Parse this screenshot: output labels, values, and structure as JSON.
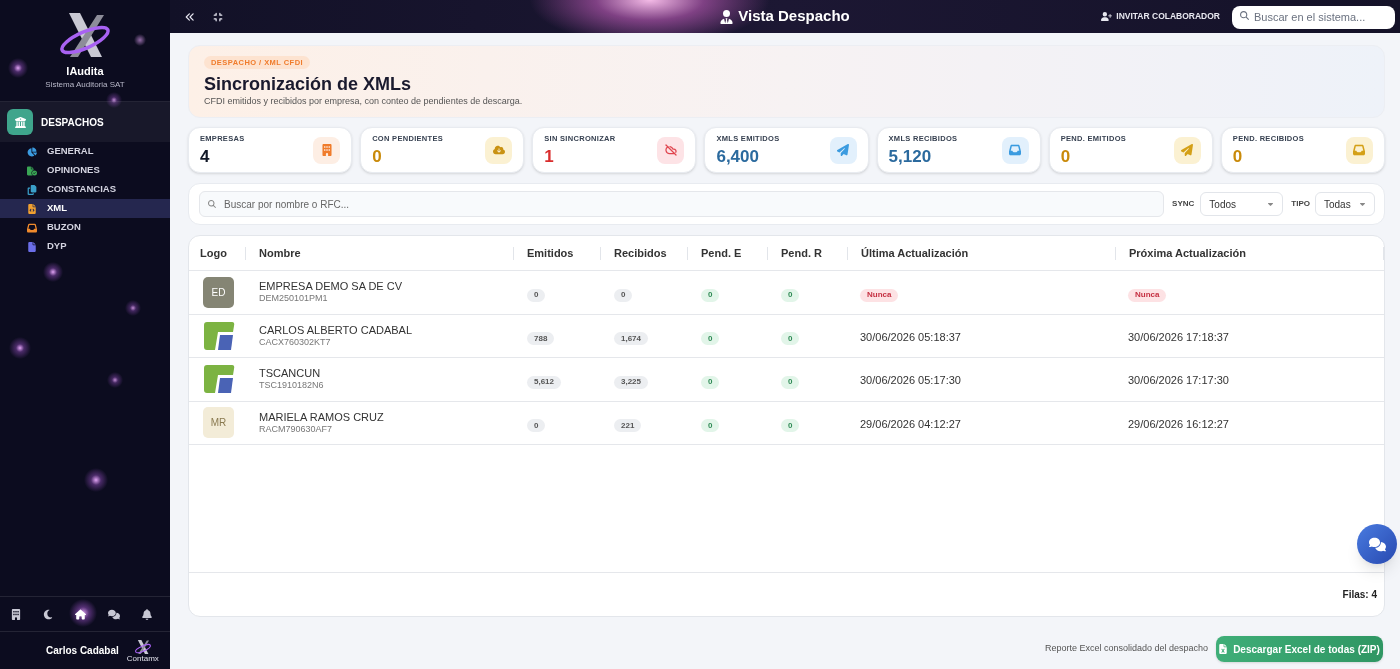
{
  "sidebar": {
    "brand": "IAudita",
    "subtitle": "Sistema Auditoria SAT",
    "section": "DESPACHOS",
    "items": [
      {
        "label": "GENERAL",
        "selected": false
      },
      {
        "label": "OPINIONES",
        "selected": false
      },
      {
        "label": "CONSTANCIAS",
        "selected": false
      },
      {
        "label": "XML",
        "selected": true
      },
      {
        "label": "BUZON",
        "selected": false
      },
      {
        "label": "DYP",
        "selected": false
      }
    ],
    "user": {
      "name": "Carlos Cadabal",
      "logo_caption": "Contamx"
    }
  },
  "header": {
    "title": "Vista Despacho",
    "invite_button": "INVITAR COLABORADOR",
    "search": {
      "placeholder": "Buscar en el sistema..."
    }
  },
  "hero": {
    "breadcrumb": "DESPACHO / XML CFDI",
    "title": "Sincronización de XMLs",
    "subtitle": "CFDI emitidos y recibidos por empresa, con conteo de pendientes de descarga."
  },
  "stats": [
    {
      "label": "EMPRESAS",
      "value": "4",
      "color": "#111827"
    },
    {
      "label": "CON PENDIENTES",
      "value": "0",
      "color": "#c98a0a"
    },
    {
      "label": "SIN SINCRONIZAR",
      "value": "1",
      "color": "#d92d2d"
    },
    {
      "label": "XMLS EMITIDOS",
      "value": "6,400",
      "color": "#2b6a9e"
    },
    {
      "label": "XMLS RECIBIDOS",
      "value": "5,120",
      "color": "#2b6a9e"
    },
    {
      "label": "PEND. EMITIDOS",
      "value": "0",
      "color": "#c98a0a"
    },
    {
      "label": "PEND. RECIBIDOS",
      "value": "0",
      "color": "#c98a0a"
    }
  ],
  "filters": {
    "search": {
      "placeholder": "Buscar por nombre o RFC..."
    },
    "sync": {
      "label": "SYNC",
      "value": "Todos"
    },
    "type": {
      "label": "TIPO",
      "value": "Todas"
    }
  },
  "table": {
    "columns": [
      "Logo",
      "Nombre",
      "Emitidos",
      "Recibidos",
      "Pend. E",
      "Pend. R",
      "Última Actualización",
      "Próxima Actualización"
    ],
    "rows": [
      {
        "logo": {
          "kind": "initials",
          "text": "ED",
          "color": "#858574"
        },
        "name": "EMPRESA DEMO SA DE CV",
        "rfc": "DEM250101PM1",
        "emitidos": "0",
        "recibidos": "0",
        "pend_e": "0",
        "pend_r": "0",
        "last_update": {
          "kind": "badge",
          "text": "Nunca"
        },
        "next_update": {
          "kind": "badge",
          "text": "Nunca"
        }
      },
      {
        "logo": {
          "kind": "image"
        },
        "name": "CARLOS ALBERTO CADABAL",
        "rfc": "CACX760302KT7",
        "emitidos": "788",
        "recibidos": "1,674",
        "pend_e": "0",
        "pend_r": "0",
        "last_update": {
          "kind": "text",
          "text": "30/06/2026 05:18:37"
        },
        "next_update": {
          "kind": "text",
          "text": "30/06/2026 17:18:37"
        }
      },
      {
        "logo": {
          "kind": "image"
        },
        "name": "TSCANCUN",
        "rfc": "TSC1910182N6",
        "emitidos": "5,612",
        "recibidos": "3,225",
        "pend_e": "0",
        "pend_r": "0",
        "last_update": {
          "kind": "text",
          "text": "30/06/2026 05:17:30"
        },
        "next_update": {
          "kind": "text",
          "text": "30/06/2026 17:17:30"
        }
      },
      {
        "logo": {
          "kind": "initials",
          "text": "MR",
          "color": "#f3ecd8"
        },
        "name": "MARIELA RAMOS CRUZ",
        "rfc": "RACM790630AF7",
        "emitidos": "0",
        "recibidos": "221",
        "pend_e": "0",
        "pend_r": "0",
        "last_update": {
          "kind": "text",
          "text": "29/06/2026 04:12:27"
        },
        "next_update": {
          "kind": "text",
          "text": "29/06/2026 16:12:27"
        }
      }
    ],
    "row_count": "Filas: 4"
  },
  "footer": {
    "note": "Reporte Excel consolidado del despacho",
    "download_button": "Descargar Excel de todas (ZIP)"
  }
}
